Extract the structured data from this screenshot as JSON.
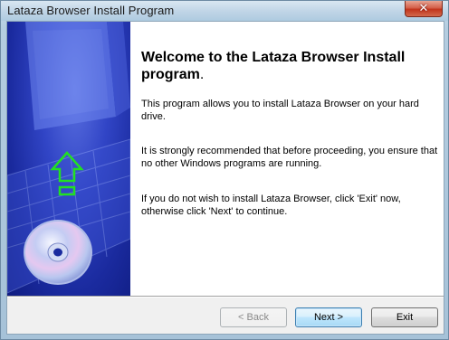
{
  "window": {
    "title": "Lataza Browser Install Program",
    "close_symbol": "✕"
  },
  "welcome": {
    "heading": "Welcome to the Lataza Browser Install program",
    "heading_period": ".",
    "paragraph_1": "This program allows you to install Lataza Browser on your hard drive.",
    "paragraph_2": "It is strongly recommended that before proceeding, you ensure that no other Windows programs are running.",
    "paragraph_3": "If you do not wish to install Lataza Browser, click 'Exit' now, otherwise click 'Next' to continue."
  },
  "buttons": {
    "back": "< Back",
    "next": "Next >",
    "exit": "Exit"
  },
  "banner": {
    "icons": [
      "monitor-graphic",
      "keyboard-graphic",
      "install-arrow-icon",
      "cd-disc-icon"
    ],
    "colors": {
      "background": "#1a2a9e",
      "arrow": "#22d622",
      "disc": "#c8d4f5"
    }
  }
}
